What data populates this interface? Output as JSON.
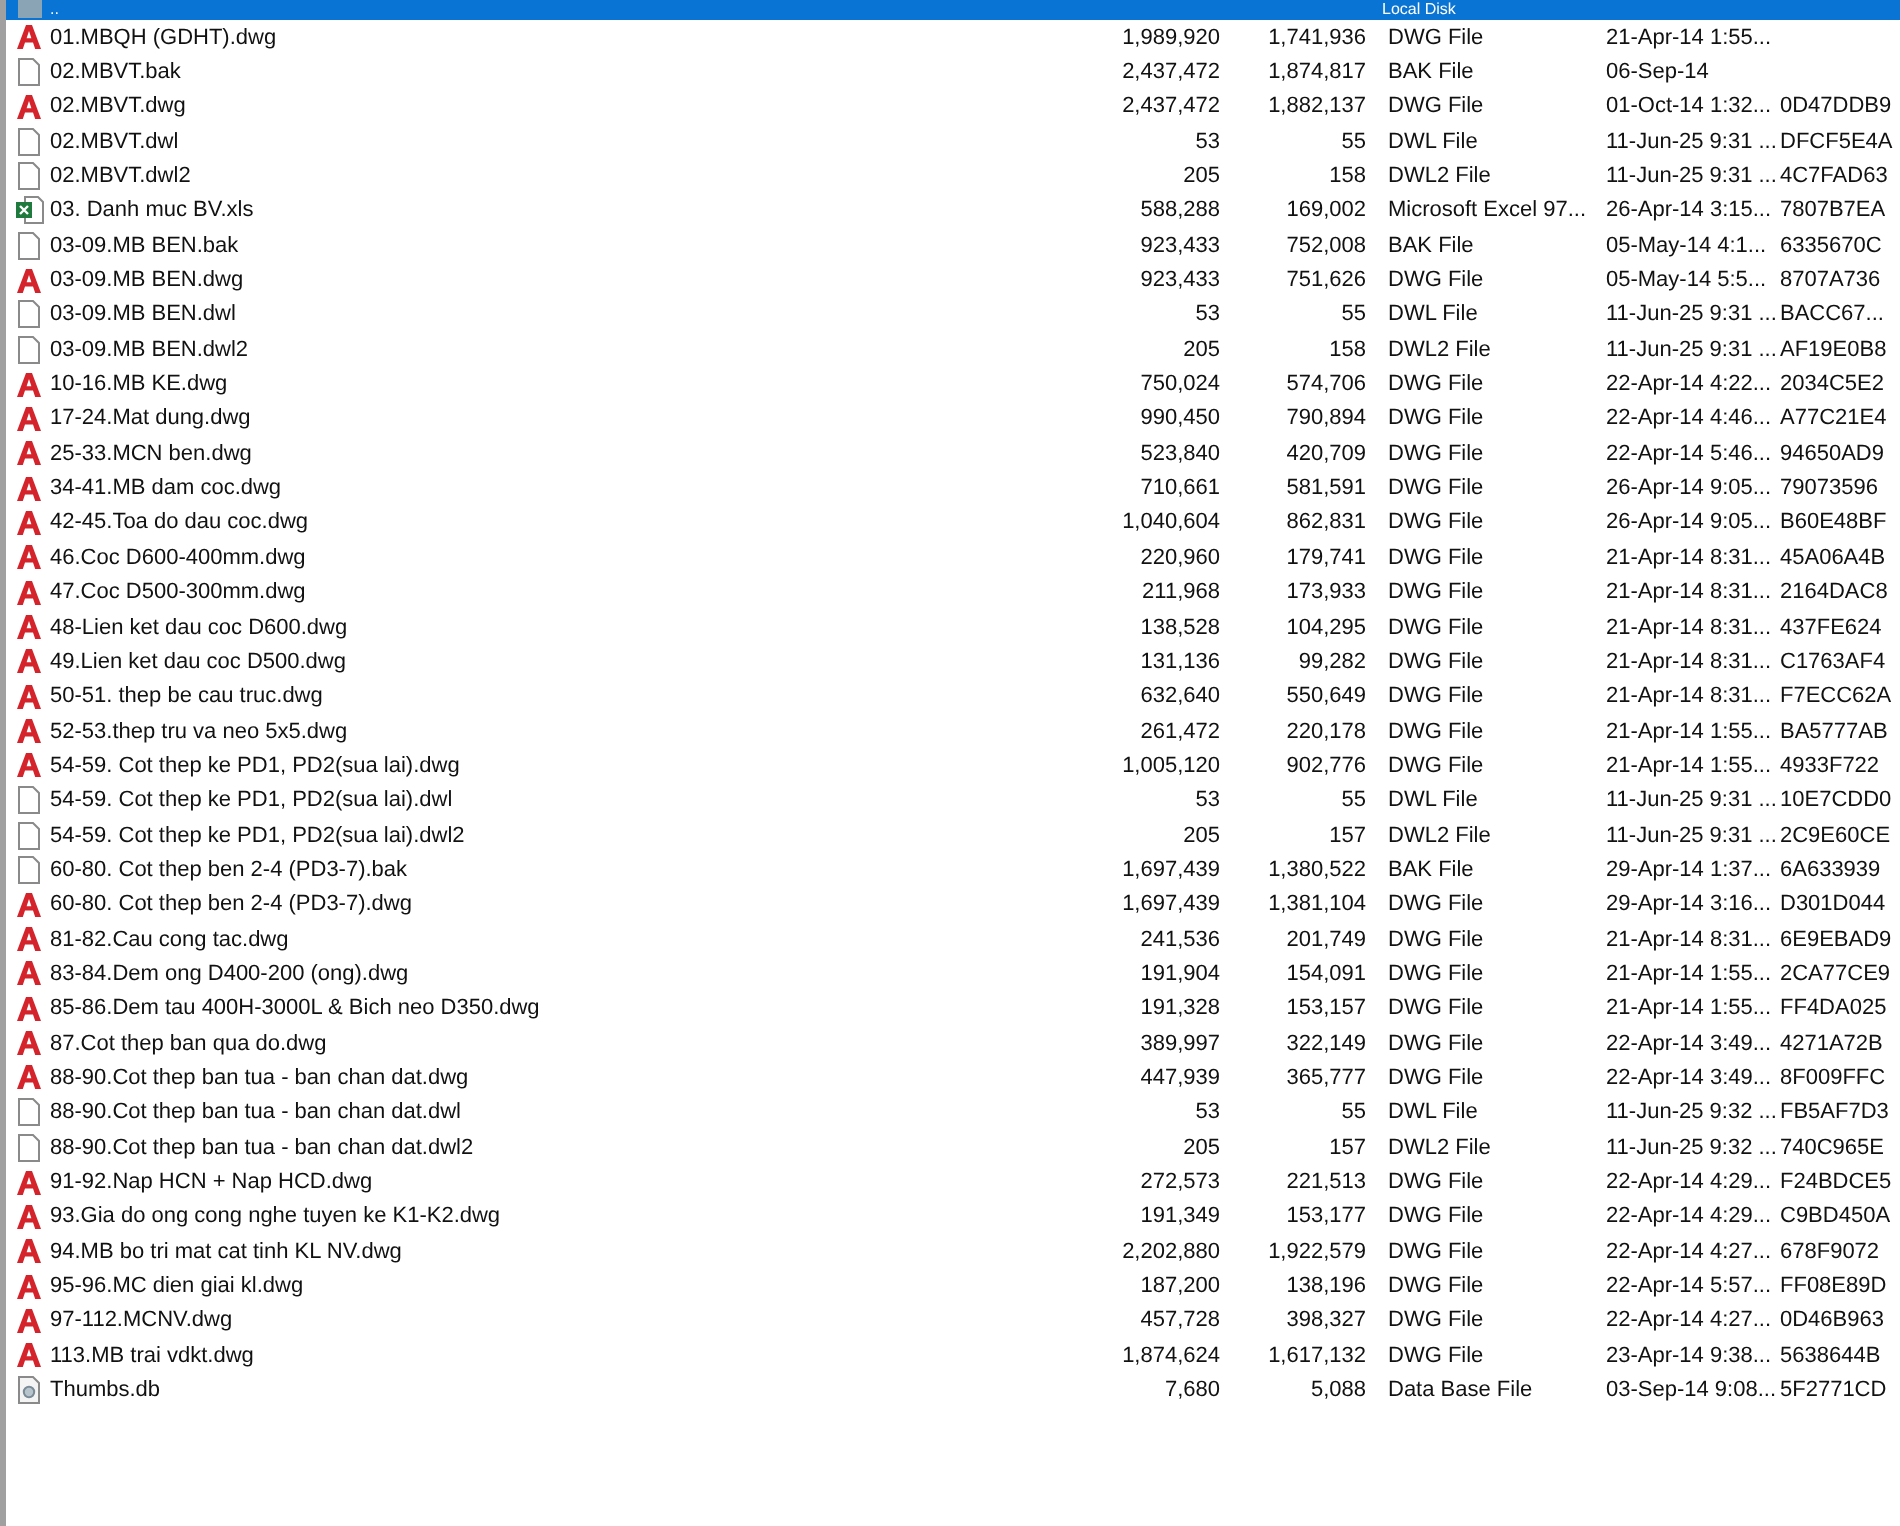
{
  "parent_row": {
    "name": "..",
    "location": "Local Disk",
    "selected": true
  },
  "files": [
    {
      "kind": "dwg",
      "name": "01.MBQH (GDHT).dwg",
      "size": "1,989,920",
      "packed": "1,741,936",
      "type": "DWG File",
      "modified": "21-Apr-14 1:55..."
    },
    {
      "kind": "file",
      "name": "02.MBVT.bak",
      "size": "2,437,472",
      "packed": "1,874,817",
      "type": "BAK File",
      "modified": "06-Sep-14"
    },
    {
      "kind": "dwg",
      "name": "02.MBVT.dwg",
      "size": "2,437,472",
      "packed": "1,882,137",
      "type": "DWG File",
      "modified": "01-Oct-14 1:32...",
      "crc": "0D47DDB9"
    },
    {
      "kind": "file",
      "name": "02.MBVT.dwl",
      "size": "53",
      "packed": "55",
      "type": "DWL File",
      "modified": "11-Jun-25 9:31 ...",
      "crc": "DFCF5E4A"
    },
    {
      "kind": "file",
      "name": "02.MBVT.dwl2",
      "size": "205",
      "packed": "158",
      "type": "DWL2 File",
      "modified": "11-Jun-25 9:31 ...",
      "crc": "4C7FAD63"
    },
    {
      "kind": "xls",
      "name": "03. Danh muc BV.xls",
      "size": "588,288",
      "packed": "169,002",
      "type": "Microsoft Excel 97...",
      "modified": "26-Apr-14 3:15...",
      "crc": "7807B7EA"
    },
    {
      "kind": "file",
      "name": "03-09.MB BEN.bak",
      "size": "923,433",
      "packed": "752,008",
      "type": "BAK File",
      "modified": "05-May-14 4:1...",
      "crc": "6335670C"
    },
    {
      "kind": "dwg",
      "name": "03-09.MB BEN.dwg",
      "size": "923,433",
      "packed": "751,626",
      "type": "DWG File",
      "modified": "05-May-14 5:5...",
      "crc": "8707A736"
    },
    {
      "kind": "file",
      "name": "03-09.MB BEN.dwl",
      "size": "53",
      "packed": "55",
      "type": "DWL File",
      "modified": "11-Jun-25 9:31 ...",
      "crc": "BACC67..."
    },
    {
      "kind": "file",
      "name": "03-09.MB BEN.dwl2",
      "size": "205",
      "packed": "158",
      "type": "DWL2 File",
      "modified": "11-Jun-25 9:31 ...",
      "crc": "AF19E0B8"
    },
    {
      "kind": "dwg",
      "name": "10-16.MB KE.dwg",
      "size": "750,024",
      "packed": "574,706",
      "type": "DWG File",
      "modified": "22-Apr-14 4:22...",
      "crc": "2034C5E2"
    },
    {
      "kind": "dwg",
      "name": "17-24.Mat dung.dwg",
      "size": "990,450",
      "packed": "790,894",
      "type": "DWG File",
      "modified": "22-Apr-14 4:46...",
      "crc": "A77C21E4"
    },
    {
      "kind": "dwg",
      "name": "25-33.MCN ben.dwg",
      "size": "523,840",
      "packed": "420,709",
      "type": "DWG File",
      "modified": "22-Apr-14 5:46...",
      "crc": "94650AD9"
    },
    {
      "kind": "dwg",
      "name": "34-41.MB dam coc.dwg",
      "size": "710,661",
      "packed": "581,591",
      "type": "DWG File",
      "modified": "26-Apr-14 9:05...",
      "crc": "79073596"
    },
    {
      "kind": "dwg",
      "name": "42-45.Toa do dau coc.dwg",
      "size": "1,040,604",
      "packed": "862,831",
      "type": "DWG File",
      "modified": "26-Apr-14 9:05...",
      "crc": "B60E48BF"
    },
    {
      "kind": "dwg",
      "name": "46.Coc D600-400mm.dwg",
      "size": "220,960",
      "packed": "179,741",
      "type": "DWG File",
      "modified": "21-Apr-14 8:31...",
      "crc": "45A06A4B"
    },
    {
      "kind": "dwg",
      "name": "47.Coc D500-300mm.dwg",
      "size": "211,968",
      "packed": "173,933",
      "type": "DWG File",
      "modified": "21-Apr-14 8:31...",
      "crc": "2164DAC8"
    },
    {
      "kind": "dwg",
      "name": "48-Lien ket dau coc D600.dwg",
      "size": "138,528",
      "packed": "104,295",
      "type": "DWG File",
      "modified": "21-Apr-14 8:31...",
      "crc": "437FE624"
    },
    {
      "kind": "dwg",
      "name": "49.Lien ket dau coc D500.dwg",
      "size": "131,136",
      "packed": "99,282",
      "type": "DWG File",
      "modified": "21-Apr-14 8:31...",
      "crc": "C1763AF4"
    },
    {
      "kind": "dwg",
      "name": "50-51. thep be cau truc.dwg",
      "size": "632,640",
      "packed": "550,649",
      "type": "DWG File",
      "modified": "21-Apr-14 8:31...",
      "crc": "F7ECC62A"
    },
    {
      "kind": "dwg",
      "name": "52-53.thep tru va neo 5x5.dwg",
      "size": "261,472",
      "packed": "220,178",
      "type": "DWG File",
      "modified": "21-Apr-14 1:55...",
      "crc": "BA5777AB"
    },
    {
      "kind": "dwg",
      "name": "54-59. Cot thep ke PD1, PD2(sua lai).dwg",
      "size": "1,005,120",
      "packed": "902,776",
      "type": "DWG File",
      "modified": "21-Apr-14 1:55...",
      "crc": "4933F722"
    },
    {
      "kind": "file",
      "name": "54-59. Cot thep ke PD1, PD2(sua lai).dwl",
      "size": "53",
      "packed": "55",
      "type": "DWL File",
      "modified": "11-Jun-25 9:31 ...",
      "crc": "10E7CDD0"
    },
    {
      "kind": "file",
      "name": "54-59. Cot thep ke PD1, PD2(sua lai).dwl2",
      "size": "205",
      "packed": "157",
      "type": "DWL2 File",
      "modified": "11-Jun-25 9:31 ...",
      "crc": "2C9E60CE"
    },
    {
      "kind": "file",
      "name": "60-80. Cot thep ben 2-4 (PD3-7).bak",
      "size": "1,697,439",
      "packed": "1,380,522",
      "type": "BAK File",
      "modified": "29-Apr-14 1:37...",
      "crc": "6A633939"
    },
    {
      "kind": "dwg",
      "name": "60-80. Cot thep ben 2-4 (PD3-7).dwg",
      "size": "1,697,439",
      "packed": "1,381,104",
      "type": "DWG File",
      "modified": "29-Apr-14 3:16...",
      "crc": "D301D044"
    },
    {
      "kind": "dwg",
      "name": "81-82.Cau cong tac.dwg",
      "size": "241,536",
      "packed": "201,749",
      "type": "DWG File",
      "modified": "21-Apr-14 8:31...",
      "crc": "6E9EBAD9"
    },
    {
      "kind": "dwg",
      "name": "83-84.Dem ong D400-200 (ong).dwg",
      "size": "191,904",
      "packed": "154,091",
      "type": "DWG File",
      "modified": "21-Apr-14 1:55...",
      "crc": "2CA77CE9"
    },
    {
      "kind": "dwg",
      "name": "85-86.Dem tau 400H-3000L & Bich neo D350.dwg",
      "size": "191,328",
      "packed": "153,157",
      "type": "DWG File",
      "modified": "21-Apr-14 1:55...",
      "crc": "FF4DA025"
    },
    {
      "kind": "dwg",
      "name": "87.Cot thep ban qua do.dwg",
      "size": "389,997",
      "packed": "322,149",
      "type": "DWG File",
      "modified": "22-Apr-14 3:49...",
      "crc": "4271A72B"
    },
    {
      "kind": "dwg",
      "name": "88-90.Cot thep ban tua - ban chan dat.dwg",
      "size": "447,939",
      "packed": "365,777",
      "type": "DWG File",
      "modified": "22-Apr-14 3:49...",
      "crc": "8F009FFC"
    },
    {
      "kind": "file",
      "name": "88-90.Cot thep ban tua - ban chan dat.dwl",
      "size": "53",
      "packed": "55",
      "type": "DWL File",
      "modified": "11-Jun-25 9:32 ...",
      "crc": "FB5AF7D3"
    },
    {
      "kind": "file",
      "name": "88-90.Cot thep ban tua - ban chan dat.dwl2",
      "size": "205",
      "packed": "157",
      "type": "DWL2 File",
      "modified": "11-Jun-25 9:32 ...",
      "crc": "740C965E"
    },
    {
      "kind": "dwg",
      "name": "91-92.Nap HCN + Nap HCD.dwg",
      "size": "272,573",
      "packed": "221,513",
      "type": "DWG File",
      "modified": "22-Apr-14 4:29...",
      "crc": "F24BDCE5"
    },
    {
      "kind": "dwg",
      "name": "93.Gia do ong cong nghe tuyen ke K1-K2.dwg",
      "size": "191,349",
      "packed": "153,177",
      "type": "DWG File",
      "modified": "22-Apr-14 4:29...",
      "crc": "C9BD450A"
    },
    {
      "kind": "dwg",
      "name": "94.MB bo tri mat cat tinh KL NV.dwg",
      "size": "2,202,880",
      "packed": "1,922,579",
      "type": "DWG File",
      "modified": "22-Apr-14 4:27...",
      "crc": "678F9072"
    },
    {
      "kind": "dwg",
      "name": "95-96.MC dien giai kl.dwg",
      "size": "187,200",
      "packed": "138,196",
      "type": "DWG File",
      "modified": "22-Apr-14 5:57...",
      "crc": "FF08E89D"
    },
    {
      "kind": "dwg",
      "name": "97-112.MCNV.dwg",
      "size": "457,728",
      "packed": "398,327",
      "type": "DWG File",
      "modified": "22-Apr-14 4:27...",
      "crc": "0D46B963"
    },
    {
      "kind": "dwg",
      "name": "113.MB trai vdkt.dwg",
      "size": "1,874,624",
      "packed": "1,617,132",
      "type": "DWG File",
      "modified": "23-Apr-14 9:38...",
      "crc": "5638644B"
    },
    {
      "kind": "db",
      "name": "Thumbs.db",
      "size": "7,680",
      "packed": "5,088",
      "type": "Data Base File",
      "modified": "03-Sep-14 9:08...",
      "crc": "5F2771CD"
    }
  ]
}
